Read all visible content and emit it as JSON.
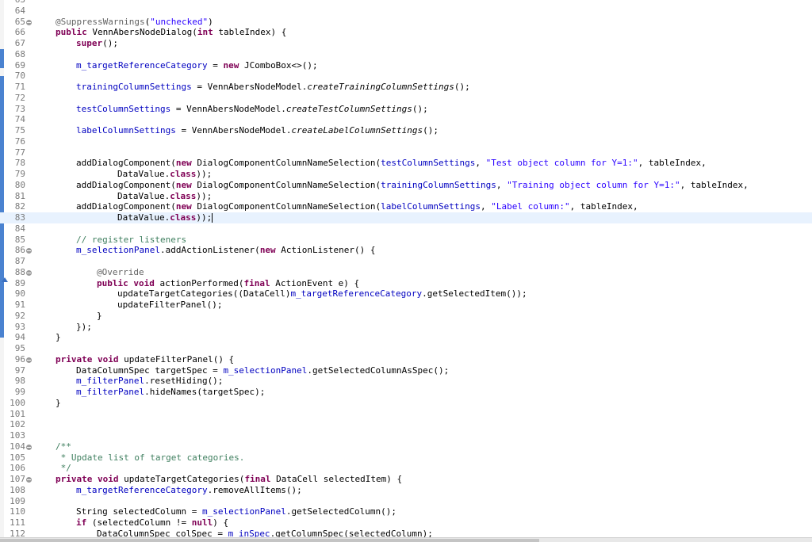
{
  "editor": {
    "language": "java",
    "first_visible_line": 63,
    "current_line": 83,
    "fold_lines": [
      65,
      86,
      88,
      96,
      104,
      107
    ],
    "lines": [
      {
        "n": 63,
        "indent": 0,
        "tokens": []
      },
      {
        "n": 64,
        "indent": 0,
        "tokens": []
      },
      {
        "n": 65,
        "indent": 0,
        "tokens": [
          {
            "t": "@SuppressWarnings",
            "c": "ann"
          },
          {
            "t": "(",
            "c": ""
          },
          {
            "t": "\"unchecked\"",
            "c": "str"
          },
          {
            "t": ")",
            "c": ""
          }
        ]
      },
      {
        "n": 66,
        "indent": 0,
        "tokens": [
          {
            "t": "public",
            "c": "kw"
          },
          {
            "t": " VennAbersNodeDialog(",
            "c": ""
          },
          {
            "t": "int",
            "c": "kw"
          },
          {
            "t": " tableIndex) {",
            "c": ""
          }
        ]
      },
      {
        "n": 67,
        "indent": 1,
        "tokens": [
          {
            "t": "super",
            "c": "kw"
          },
          {
            "t": "();",
            "c": ""
          }
        ]
      },
      {
        "n": 68,
        "indent": 0,
        "tokens": []
      },
      {
        "n": 69,
        "indent": 1,
        "tokens": [
          {
            "t": "m_targetReferenceCategory",
            "c": "fld"
          },
          {
            "t": " = ",
            "c": ""
          },
          {
            "t": "new",
            "c": "kw"
          },
          {
            "t": " JComboBox<>();",
            "c": ""
          }
        ]
      },
      {
        "n": 70,
        "indent": 0,
        "tokens": []
      },
      {
        "n": 71,
        "indent": 1,
        "tokens": [
          {
            "t": "trainingColumnSettings",
            "c": "fld"
          },
          {
            "t": " = VennAbersNodeModel.",
            "c": ""
          },
          {
            "t": "createTrainingColumnSettings",
            "c": "it"
          },
          {
            "t": "();",
            "c": ""
          }
        ]
      },
      {
        "n": 72,
        "indent": 0,
        "tokens": []
      },
      {
        "n": 73,
        "indent": 1,
        "tokens": [
          {
            "t": "testColumnSettings",
            "c": "fld"
          },
          {
            "t": " = VennAbersNodeModel.",
            "c": ""
          },
          {
            "t": "createTestColumnSettings",
            "c": "it"
          },
          {
            "t": "();",
            "c": ""
          }
        ]
      },
      {
        "n": 74,
        "indent": 0,
        "tokens": []
      },
      {
        "n": 75,
        "indent": 1,
        "tokens": [
          {
            "t": "labelColumnSettings",
            "c": "fld"
          },
          {
            "t": " = VennAbersNodeModel.",
            "c": ""
          },
          {
            "t": "createLabelColumnSettings",
            "c": "it"
          },
          {
            "t": "();",
            "c": ""
          }
        ]
      },
      {
        "n": 76,
        "indent": 0,
        "tokens": []
      },
      {
        "n": 77,
        "indent": 0,
        "tokens": []
      },
      {
        "n": 78,
        "indent": 1,
        "tokens": [
          {
            "t": "addDialogComponent(",
            "c": ""
          },
          {
            "t": "new",
            "c": "kw"
          },
          {
            "t": " DialogComponentColumnNameSelection(",
            "c": ""
          },
          {
            "t": "testColumnSettings",
            "c": "fld"
          },
          {
            "t": ", ",
            "c": ""
          },
          {
            "t": "\"Test object column for Y=1:\"",
            "c": "str"
          },
          {
            "t": ", tableIndex,",
            "c": ""
          }
        ]
      },
      {
        "n": 79,
        "indent": 3,
        "tokens": [
          {
            "t": "DataValue.",
            "c": ""
          },
          {
            "t": "class",
            "c": "kw"
          },
          {
            "t": "));",
            "c": ""
          }
        ]
      },
      {
        "n": 80,
        "indent": 1,
        "tokens": [
          {
            "t": "addDialogComponent(",
            "c": ""
          },
          {
            "t": "new",
            "c": "kw"
          },
          {
            "t": " DialogComponentColumnNameSelection(",
            "c": ""
          },
          {
            "t": "trainingColumnSettings",
            "c": "fld"
          },
          {
            "t": ", ",
            "c": ""
          },
          {
            "t": "\"Training object column for Y=1:\"",
            "c": "str"
          },
          {
            "t": ", tableIndex,",
            "c": ""
          }
        ]
      },
      {
        "n": 81,
        "indent": 3,
        "tokens": [
          {
            "t": "DataValue.",
            "c": ""
          },
          {
            "t": "class",
            "c": "kw"
          },
          {
            "t": "));",
            "c": ""
          }
        ]
      },
      {
        "n": 82,
        "indent": 1,
        "tokens": [
          {
            "t": "addDialogComponent(",
            "c": ""
          },
          {
            "t": "new",
            "c": "kw"
          },
          {
            "t": " DialogComponentColumnNameSelection(",
            "c": ""
          },
          {
            "t": "labelColumnSettings",
            "c": "fld"
          },
          {
            "t": ", ",
            "c": ""
          },
          {
            "t": "\"Label column:\"",
            "c": "str"
          },
          {
            "t": ", tableIndex,",
            "c": ""
          }
        ]
      },
      {
        "n": 83,
        "indent": 3,
        "tokens": [
          {
            "t": "DataValue.",
            "c": ""
          },
          {
            "t": "class",
            "c": "kw"
          },
          {
            "t": "));",
            "c": ""
          }
        ],
        "cursor": true
      },
      {
        "n": 84,
        "indent": 0,
        "tokens": []
      },
      {
        "n": 85,
        "indent": 1,
        "tokens": [
          {
            "t": "// register listeners",
            "c": "cm"
          }
        ]
      },
      {
        "n": 86,
        "indent": 1,
        "tokens": [
          {
            "t": "m_selectionPanel",
            "c": "fld"
          },
          {
            "t": ".addActionListener(",
            "c": ""
          },
          {
            "t": "new",
            "c": "kw"
          },
          {
            "t": " ActionListener() {",
            "c": ""
          }
        ]
      },
      {
        "n": 87,
        "indent": 0,
        "tokens": []
      },
      {
        "n": 88,
        "indent": 2,
        "tokens": [
          {
            "t": "@Override",
            "c": "ann"
          }
        ]
      },
      {
        "n": 89,
        "indent": 2,
        "tokens": [
          {
            "t": "public",
            "c": "kw"
          },
          {
            "t": " ",
            "c": ""
          },
          {
            "t": "void",
            "c": "kw"
          },
          {
            "t": " actionPerformed(",
            "c": ""
          },
          {
            "t": "final",
            "c": "kw"
          },
          {
            "t": " ActionEvent e) {",
            "c": ""
          }
        ]
      },
      {
        "n": 90,
        "indent": 3,
        "tokens": [
          {
            "t": "updateTargetCategories((DataCell)",
            "c": ""
          },
          {
            "t": "m_targetReferenceCategory",
            "c": "fld"
          },
          {
            "t": ".getSelectedItem());",
            "c": ""
          }
        ]
      },
      {
        "n": 91,
        "indent": 3,
        "tokens": [
          {
            "t": "updateFilterPanel();",
            "c": ""
          }
        ]
      },
      {
        "n": 92,
        "indent": 2,
        "tokens": [
          {
            "t": "}",
            "c": ""
          }
        ]
      },
      {
        "n": 93,
        "indent": 1,
        "tokens": [
          {
            "t": "});",
            "c": ""
          }
        ]
      },
      {
        "n": 94,
        "indent": 0,
        "tokens": [
          {
            "t": "}",
            "c": ""
          }
        ]
      },
      {
        "n": 95,
        "indent": 0,
        "tokens": []
      },
      {
        "n": 96,
        "indent": 0,
        "tokens": [
          {
            "t": "private",
            "c": "kw"
          },
          {
            "t": " ",
            "c": ""
          },
          {
            "t": "void",
            "c": "kw"
          },
          {
            "t": " updateFilterPanel() {",
            "c": ""
          }
        ]
      },
      {
        "n": 97,
        "indent": 1,
        "tokens": [
          {
            "t": "DataColumnSpec targetSpec = ",
            "c": ""
          },
          {
            "t": "m_selectionPanel",
            "c": "fld"
          },
          {
            "t": ".getSelectedColumnAsSpec();",
            "c": ""
          }
        ]
      },
      {
        "n": 98,
        "indent": 1,
        "tokens": [
          {
            "t": "m_filterPanel",
            "c": "fld"
          },
          {
            "t": ".resetHiding();",
            "c": ""
          }
        ]
      },
      {
        "n": 99,
        "indent": 1,
        "tokens": [
          {
            "t": "m_filterPanel",
            "c": "fld"
          },
          {
            "t": ".hideNames(targetSpec);",
            "c": ""
          }
        ]
      },
      {
        "n": 100,
        "indent": 0,
        "tokens": [
          {
            "t": "}",
            "c": ""
          }
        ]
      },
      {
        "n": 101,
        "indent": 0,
        "tokens": []
      },
      {
        "n": 102,
        "indent": 0,
        "tokens": []
      },
      {
        "n": 103,
        "indent": 0,
        "tokens": []
      },
      {
        "n": 104,
        "indent": 0,
        "tokens": [
          {
            "t": "/**",
            "c": "cm"
          }
        ]
      },
      {
        "n": 105,
        "indent": 0,
        "tokens": [
          {
            "t": " * Update list of target categories.",
            "c": "cm"
          }
        ]
      },
      {
        "n": 106,
        "indent": 0,
        "tokens": [
          {
            "t": " */",
            "c": "cm"
          }
        ]
      },
      {
        "n": 107,
        "indent": 0,
        "tokens": [
          {
            "t": "private",
            "c": "kw"
          },
          {
            "t": " ",
            "c": ""
          },
          {
            "t": "void",
            "c": "kw"
          },
          {
            "t": " updateTargetCategories(",
            "c": ""
          },
          {
            "t": "final",
            "c": "kw"
          },
          {
            "t": " DataCell selectedItem) {",
            "c": ""
          }
        ]
      },
      {
        "n": 108,
        "indent": 1,
        "tokens": [
          {
            "t": "m_targetReferenceCategory",
            "c": "fld"
          },
          {
            "t": ".removeAllItems();",
            "c": ""
          }
        ]
      },
      {
        "n": 109,
        "indent": 0,
        "tokens": []
      },
      {
        "n": 110,
        "indent": 1,
        "tokens": [
          {
            "t": "String selectedColumn = ",
            "c": ""
          },
          {
            "t": "m_selectionPanel",
            "c": "fld"
          },
          {
            "t": ".getSelectedColumn();",
            "c": ""
          }
        ]
      },
      {
        "n": 111,
        "indent": 1,
        "tokens": [
          {
            "t": "if",
            "c": "kw"
          },
          {
            "t": " (selectedColumn != ",
            "c": ""
          },
          {
            "t": "null",
            "c": "kw"
          },
          {
            "t": ") {",
            "c": ""
          }
        ]
      },
      {
        "n": 112,
        "indent": 2,
        "tokens": [
          {
            "t": "DataColumnSpec colSpec = ",
            "c": ""
          },
          {
            "t": "m_inSpec",
            "c": "fld"
          },
          {
            "t": ".getColumnSpec(selectedColumn);",
            "c": ""
          }
        ]
      }
    ]
  }
}
